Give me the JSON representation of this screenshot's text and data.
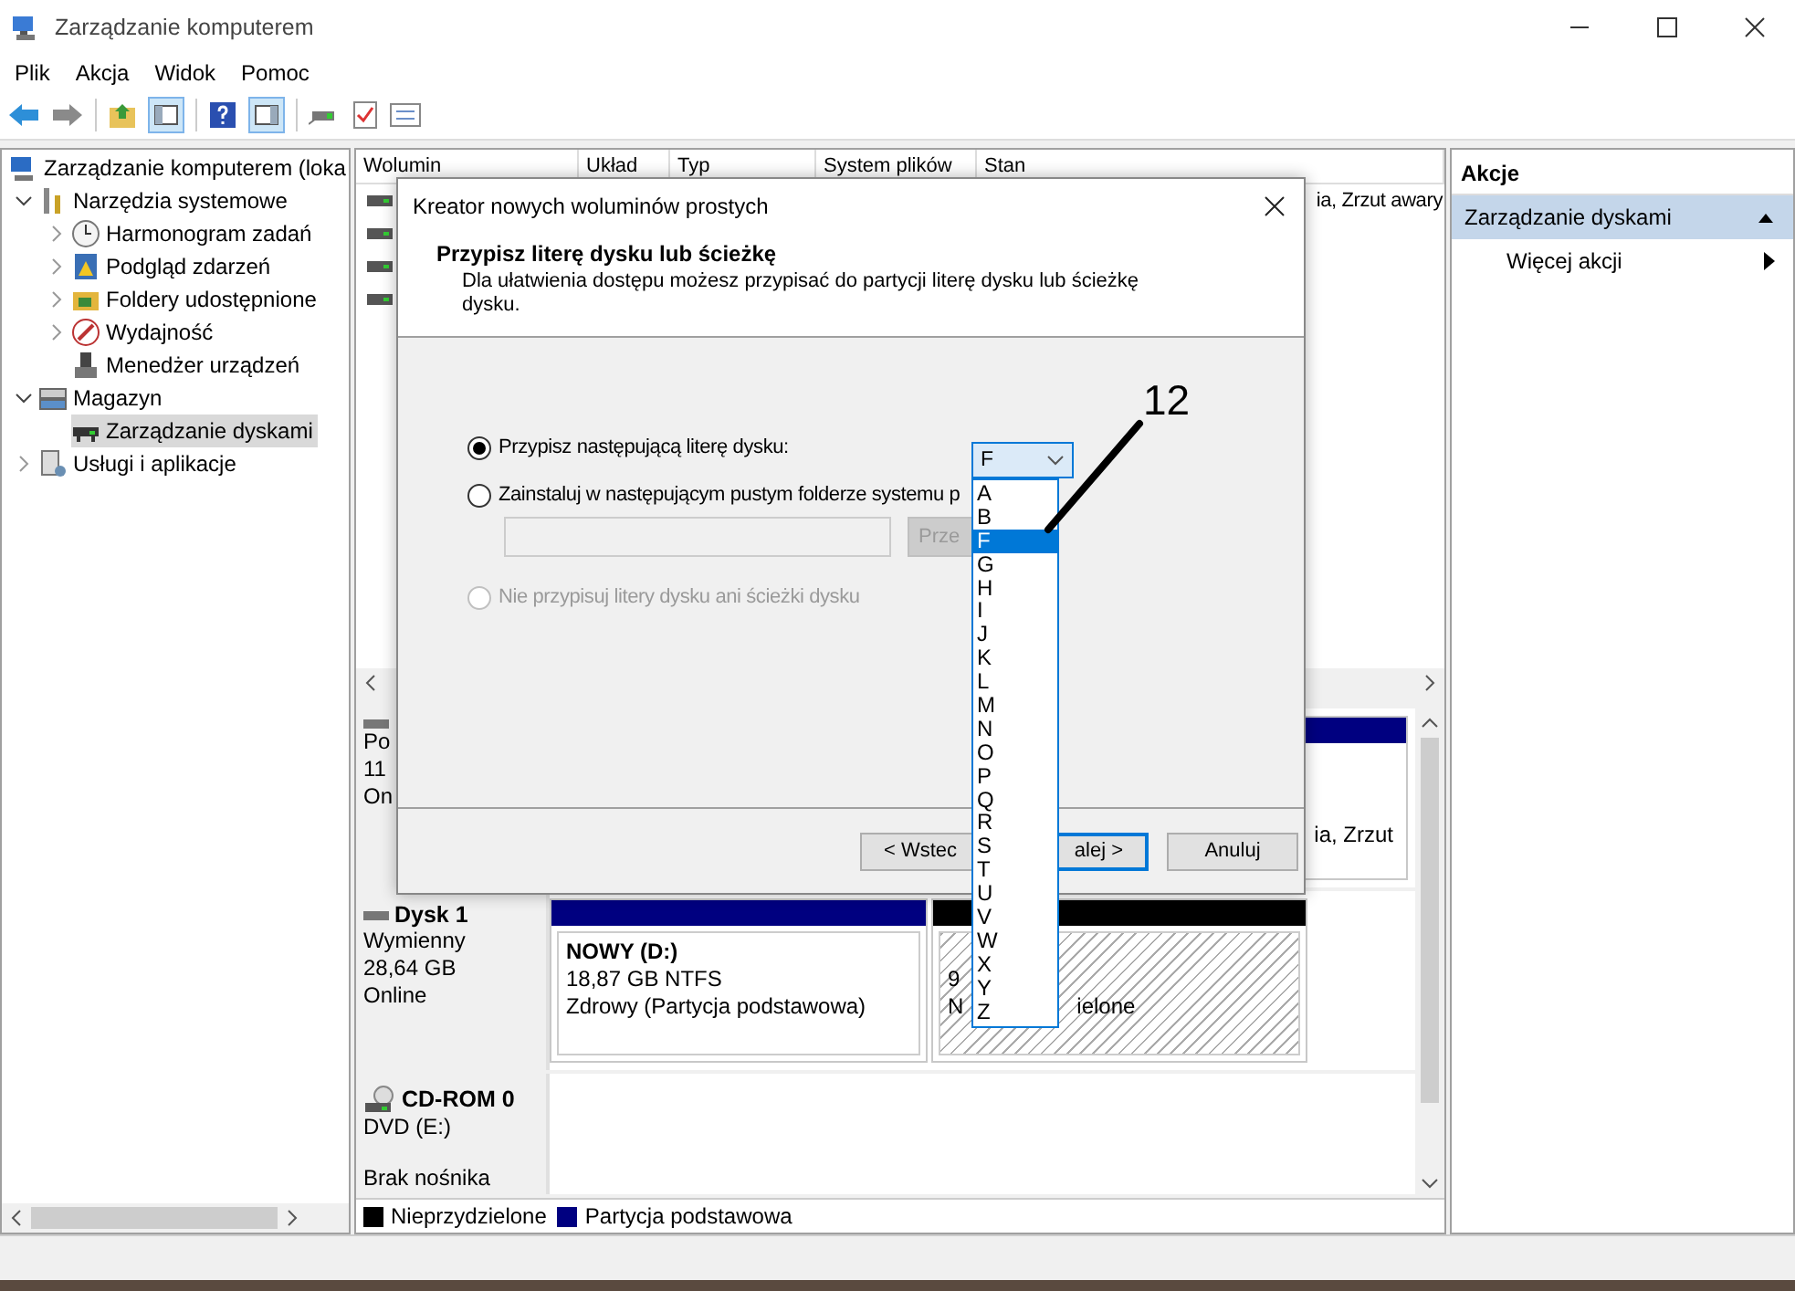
{
  "window": {
    "title": "Zarządzanie komputerem"
  },
  "menu": [
    "Plik",
    "Akcja",
    "Widok",
    "Pomoc"
  ],
  "tree": {
    "items": [
      {
        "label": "Zarządzanie komputerem (loka",
        "kind": "computer",
        "selected": false,
        "children": [
          {
            "label": "Narzędzia systemowe",
            "kind": "tools",
            "expanded": true,
            "selected": false,
            "children": [
              {
                "label": "Harmonogram zadań",
                "kind": "clock",
                "expanded": false,
                "selected": false
              },
              {
                "label": "Podgląd zdarzeń",
                "kind": "log",
                "expanded": false,
                "selected": false
              },
              {
                "label": "Foldery udostępnione",
                "kind": "folder",
                "expanded": false,
                "selected": false
              },
              {
                "label": "Wydajność",
                "kind": "gauge",
                "expanded": false,
                "selected": false
              },
              {
                "label": "Menedżer urządzeń",
                "kind": "device",
                "selected": false
              }
            ]
          },
          {
            "label": "Magazyn",
            "kind": "storage",
            "expanded": true,
            "selected": false,
            "children": [
              {
                "label": "Zarządzanie dyskami",
                "kind": "drive",
                "selected": true
              }
            ]
          },
          {
            "label": "Usługi i aplikacje",
            "kind": "services",
            "expanded": false,
            "selected": false
          }
        ]
      }
    ]
  },
  "volumes": {
    "columns": [
      "Wolumin",
      "Układ",
      "Typ",
      "System plików",
      "Stan"
    ],
    "rows": [
      {
        "status": "ia, Zrzut awary"
      },
      {},
      {},
      {}
    ]
  },
  "disks": [
    {
      "kind": "disk",
      "lines": [
        "Po",
        "11",
        "On"
      ],
      "partitions": [
        {
          "kind": "primary",
          "lines": [
            [
              "ia, Zrzut"
            ]
          ]
        }
      ]
    },
    {
      "kind": "disk",
      "name": "Dysk 1",
      "lines": [
        "Wymienny",
        "28,64 GB",
        "Online"
      ],
      "partitions": [
        {
          "kind": "primary",
          "title": "NOWY  (D:)",
          "lines": [
            [
              "18,87 GB NTFS"
            ],
            [
              "Zdrowy (Partycja podstawowa)"
            ]
          ]
        },
        {
          "kind": "unallocated",
          "lines": [
            [
              "9"
            ],
            [
              "N",
              "ielone"
            ]
          ]
        }
      ]
    },
    {
      "kind": "cdrom",
      "name": "CD-ROM 0",
      "lines": [
        "DVD (E:)"
      ],
      "status": "Brak nośnika"
    }
  ],
  "legend": [
    {
      "label": "Nieprzydzielone",
      "color": "#000000"
    },
    {
      "label": "Partycja podstawowa",
      "color": "#000080"
    }
  ],
  "actions": {
    "title": "Akcje",
    "sections": [
      {
        "label": "Zarządzanie dyskami",
        "selected": true,
        "expanded": true,
        "items": [
          {
            "label": "Więcej akcji"
          }
        ]
      }
    ]
  },
  "dialog": {
    "title": "Kreator nowych woluminów prostych",
    "heading": "Przypisz literę dysku lub ścieżkę",
    "description": "Dla ułatwienia dostępu możesz przypisać do partycji literę dysku lub ścieżkę dysku.",
    "options": [
      {
        "label": "Przypisz następującą literę dysku:",
        "selected": true,
        "disabled": false
      },
      {
        "label": "Zainstaluj w następującym pustym folderze systemu p",
        "selected": false,
        "disabled": false
      },
      {
        "label": "Nie przypisuj litery dysku ani ścieżki dysku",
        "selected": false,
        "disabled": true
      }
    ],
    "letter_combo": {
      "value": "F",
      "expanded": true,
      "options": [
        {
          "label": "A",
          "selected": false
        },
        {
          "label": "B",
          "selected": false
        },
        {
          "label": "F",
          "selected": true
        },
        {
          "label": "G",
          "selected": false
        },
        {
          "label": "H",
          "selected": false
        },
        {
          "label": "I",
          "selected": false
        },
        {
          "label": "J",
          "selected": false
        },
        {
          "label": "K",
          "selected": false
        },
        {
          "label": "L",
          "selected": false
        },
        {
          "label": "M",
          "selected": false
        },
        {
          "label": "N",
          "selected": false
        },
        {
          "label": "O",
          "selected": false
        },
        {
          "label": "P",
          "selected": false
        },
        {
          "label": "Q",
          "selected": false
        },
        {
          "label": "R",
          "selected": false
        },
        {
          "label": "S",
          "selected": false
        },
        {
          "label": "T",
          "selected": false
        },
        {
          "label": "U",
          "selected": false
        },
        {
          "label": "V",
          "selected": false
        },
        {
          "label": "W",
          "selected": false
        },
        {
          "label": "X",
          "selected": false
        },
        {
          "label": "Y",
          "selected": false
        },
        {
          "label": "Z",
          "selected": false
        }
      ]
    },
    "folder_field": {
      "disabled": true
    },
    "browse_button": {
      "label": "Prze",
      "disabled": true
    },
    "buttons": [
      {
        "label": "< Wstec",
        "kind": "back",
        "default": false
      },
      {
        "label": "alej >",
        "kind": "next",
        "default": true
      },
      {
        "label": "Anuluj",
        "kind": "cancel",
        "default": false
      }
    ]
  },
  "callout": {
    "label": "12"
  }
}
